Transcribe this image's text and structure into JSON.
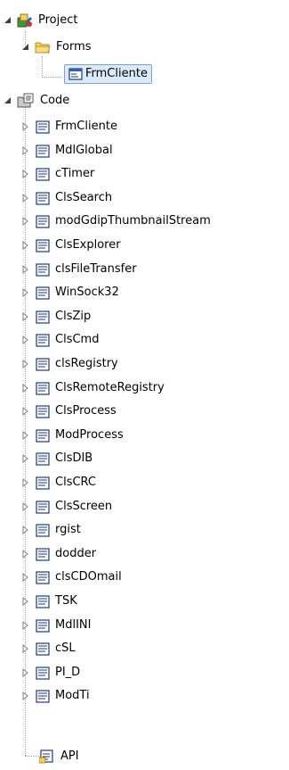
{
  "tree": {
    "project": {
      "label": "Project",
      "icon": "project-icon",
      "expanded": true
    },
    "forms": {
      "label": "Forms",
      "icon": "folder-icon",
      "expanded": true
    },
    "form_items": [
      {
        "label": "FrmCliente",
        "icon": "form-icon",
        "selected": true
      }
    ],
    "code": {
      "label": "Code",
      "icon": "code-folder-icon",
      "expanded": true
    },
    "module_items": [
      {
        "label": "FrmCliente"
      },
      {
        "label": "MdlGlobal"
      },
      {
        "label": "cTimer"
      },
      {
        "label": "ClsSearch"
      },
      {
        "label": "modGdipThumbnailStream"
      },
      {
        "label": "ClsExplorer"
      },
      {
        "label": "clsFileTransfer"
      },
      {
        "label": "WinSock32"
      },
      {
        "label": "ClsZip"
      },
      {
        "label": "ClsCmd"
      },
      {
        "label": "clsRegistry"
      },
      {
        "label": "ClsRemoteRegistry"
      },
      {
        "label": "ClsProcess"
      },
      {
        "label": "ModProcess"
      },
      {
        "label": "ClsDIB"
      },
      {
        "label": "ClsCRC"
      },
      {
        "label": "ClsScreen"
      },
      {
        "label": "rgist"
      },
      {
        "label": "dodder"
      },
      {
        "label": "clsCDOmail"
      },
      {
        "label": "TSK"
      },
      {
        "label": "MdlINI"
      },
      {
        "label": "cSL"
      },
      {
        "label": "PI_D"
      },
      {
        "label": "ModTi"
      }
    ],
    "api_item": {
      "label": "API",
      "icon": "api-module-icon"
    }
  },
  "colors": {
    "selection_bg": "#dcebfc",
    "selection_border": "#7da2ce",
    "connector": "#a0a0a0",
    "expander": "#404040",
    "module_icon_frame": "#1f3a78",
    "folder_yellow": "#f4cf5a"
  }
}
